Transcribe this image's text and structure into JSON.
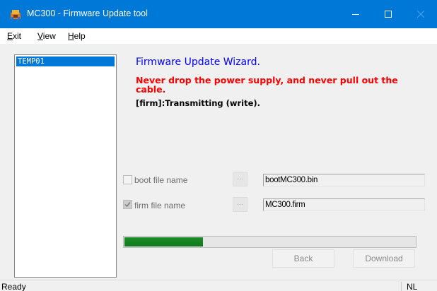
{
  "window": {
    "title": "MC300 - Firmware Update tool",
    "icon": "app-icon",
    "controls": [
      "minimize-icon",
      "maximize-icon",
      "close-icon"
    ]
  },
  "menu": {
    "items": [
      {
        "accel": "E",
        "rest": "xit"
      },
      {
        "accel": "V",
        "rest": "iew"
      },
      {
        "accel": "H",
        "rest": "elp"
      }
    ]
  },
  "device_list": {
    "items": [
      "TEMP01"
    ],
    "selected": "TEMP01"
  },
  "wizard": {
    "title": "Firmware Update Wizard.",
    "warning": "Never drop the power supply, and never pull out the cable.",
    "status": "[firm]:Transmitting (write)."
  },
  "files": {
    "boot": {
      "label": "boot file name",
      "checked": false,
      "browse_label": "...",
      "value": "bootMC300.bin"
    },
    "firm": {
      "label": "firm file name",
      "checked": true,
      "browse_label": "...",
      "value": "MC300.firm"
    }
  },
  "progress": {
    "value": 0.27
  },
  "buttons": {
    "back": "Back",
    "download": "Download"
  },
  "statusbar": {
    "left": "Ready",
    "right": "NL"
  },
  "colors": {
    "titlebar": "#0078d7",
    "wizard_title": "#0000ff",
    "warning": "#ff0000",
    "progress_fill": "#1c8d27",
    "selection": "#0078d7"
  }
}
